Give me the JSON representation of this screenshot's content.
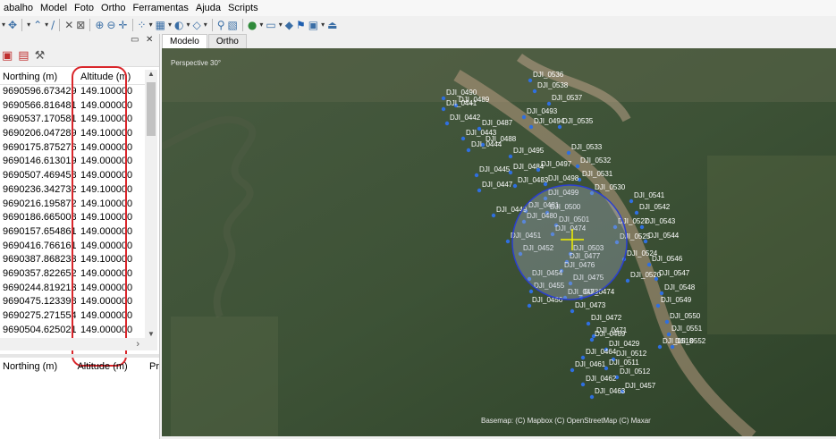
{
  "menu": {
    "items": [
      "abalho",
      "Model",
      "Foto",
      "Ortho",
      "Ferramentas",
      "Ajuda",
      "Scripts"
    ]
  },
  "toolbar": {
    "icons": [
      "dropdown-arrow-icon",
      "move-icon",
      "dropdown-arrow-icon",
      "polyline-icon",
      "dropdown-arrow-icon",
      "pencil-icon",
      "delete-icon",
      "crop-icon",
      "zoom-in-icon",
      "zoom-out-icon",
      "navigate-icon",
      "point-cloud-icon",
      "dropdown-arrow-icon",
      "grid-icon",
      "dropdown-arrow-icon",
      "shading-icon",
      "dropdown-arrow-icon",
      "cameras-icon",
      "dropdown-arrow-icon",
      "markers-icon",
      "texture-icon",
      "globe-icon",
      "dropdown-arrow-icon",
      "image-icon",
      "dropdown-arrow-icon",
      "shape-icon",
      "flag-icon",
      "photo-icon",
      "dropdown-arrow-icon",
      "ruler-icon"
    ]
  },
  "reference_panel": {
    "headers": {
      "northing": "Northing (m)",
      "altitude": "Altitude (m)"
    },
    "rows": [
      {
        "northing": "9690596.673429",
        "altitude": "149.100000"
      },
      {
        "northing": "9690566.816481",
        "altitude": "149.000000"
      },
      {
        "northing": "9690537.170581",
        "altitude": "149.100000"
      },
      {
        "northing": "9690206.047289",
        "altitude": "149.100000"
      },
      {
        "northing": "9690175.875276",
        "altitude": "149.000000"
      },
      {
        "northing": "9690146.613019",
        "altitude": "149.000000"
      },
      {
        "northing": "9690507.469458",
        "altitude": "149.000000"
      },
      {
        "northing": "9690236.342732",
        "altitude": "149.100000"
      },
      {
        "northing": "9690216.195872",
        "altitude": "149.100000"
      },
      {
        "northing": "9690186.665008",
        "altitude": "149.100000"
      },
      {
        "northing": "9690157.654861",
        "altitude": "149.000000"
      },
      {
        "northing": "9690416.766161",
        "altitude": "149.000000"
      },
      {
        "northing": "9690387.868233",
        "altitude": "149.100000"
      },
      {
        "northing": "9690357.822652",
        "altitude": "149.000000"
      },
      {
        "northing": "9690244.819213",
        "altitude": "149.000000"
      },
      {
        "northing": "9690475.123398",
        "altitude": "149.000000"
      },
      {
        "northing": "9690275.271554",
        "altitude": "149.000000"
      },
      {
        "northing": "9690504.625021",
        "altitude": "149.000000"
      }
    ],
    "lower_headers": {
      "northing": "Northing (m)",
      "altitude": "Altitude (m)",
      "extra": "Pr"
    }
  },
  "tabs": [
    {
      "label": "Modelo",
      "active": true
    },
    {
      "label": "Ortho",
      "active": false
    }
  ],
  "viewport": {
    "perspective_label": "Perspective 30°",
    "attribution": "Basemap: (C) Mapbox (C) OpenStreetMap (C) Maxar",
    "camera_labels": [
      "DJI_0536",
      "DJI_0538",
      "DJI_0490",
      "DJI_0489",
      "DJI_0441",
      "DJI_0537",
      "DJI_0493",
      "DJI_0442",
      "DJI_0487",
      "DJI_0494",
      "DJI_0535",
      "DJI_0443",
      "DJI_0488",
      "DJI_0444",
      "DJI_0495",
      "DJI_0533",
      "DJI_0532",
      "DJI_0445",
      "DJI_0484",
      "DJI_0497",
      "DJI_0531",
      "DJI_0483",
      "DJI_0498",
      "DJI_0447",
      "DJI_0530",
      "DJI_0499",
      "DJI_0541",
      "DJI_0481",
      "DJI_0500",
      "DJI_0542",
      "DJI_0449",
      "DJI_0480",
      "DJI_0501",
      "DJI_0527",
      "DJI_0543",
      "DJI_0474",
      "DJI_0451",
      "DJI_0544",
      "DJI_0525",
      "DJI_0452",
      "DJI_0503",
      "DJI_0477",
      "DJI_0524",
      "DJI_0546",
      "DJI_0476",
      "DJI_0454",
      "DJI_0475",
      "DJI_0520",
      "DJI_0547",
      "DJI_0455",
      "DJI_0548",
      "DJI_0473",
      "DJI_0474",
      "DJI_0456",
      "DJI_0549",
      "DJI_0473",
      "DJI_0472",
      "DJI_0550",
      "DJI_0471",
      "DJI_0551",
      "DJI_0469",
      "DJI_0518",
      "DJI_0552",
      "DJI_0429",
      "DJI_0464",
      "DJI_0512",
      "DJI_0511",
      "DJI_0461",
      "DJI_0512",
      "DJI_0462",
      "DJI_0457",
      "DJI_0463"
    ]
  },
  "colors": {
    "selection_circle": "#2a3fd0",
    "crosshair": "#f0f000",
    "camera_dot": "#2f6fe0",
    "highlight": "#d9262b"
  }
}
